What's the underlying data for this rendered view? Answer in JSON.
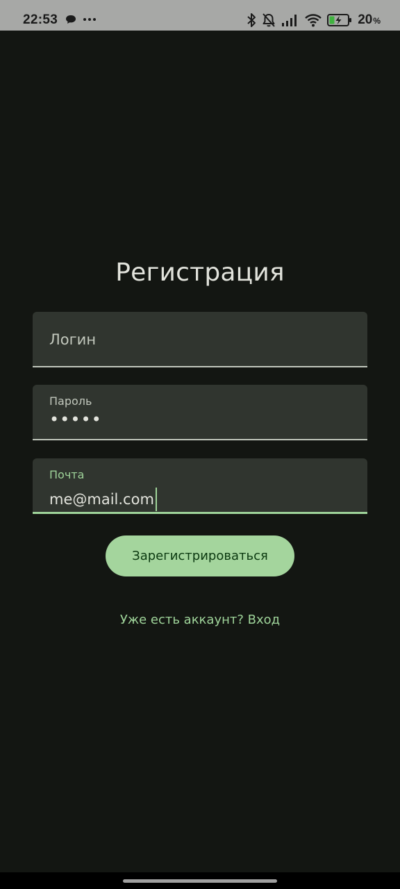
{
  "status_bar": {
    "time": "22:53",
    "icons": [
      "chat-bubble-icon",
      "more-dots-icon",
      "bluetooth-icon",
      "bell-off-icon",
      "signal-icon",
      "wifi-icon",
      "battery-charging-icon"
    ],
    "battery_value": "20",
    "battery_unit": "%"
  },
  "screen": {
    "title": "Регистрация"
  },
  "form": {
    "login_placeholder": "Логин",
    "password_label": "Пароль",
    "password_value": "•••••",
    "email_label": "Почта",
    "email_value": "me@mail.com"
  },
  "actions": {
    "register_label": "Зарегистрироваться",
    "login_link": "Уже есть аккаунт? Вход"
  },
  "colors": {
    "background": "#131612",
    "field_background": "#30352f",
    "accent": "#9fd49a",
    "button": "#a4d59d",
    "button_text": "#0b3910"
  }
}
